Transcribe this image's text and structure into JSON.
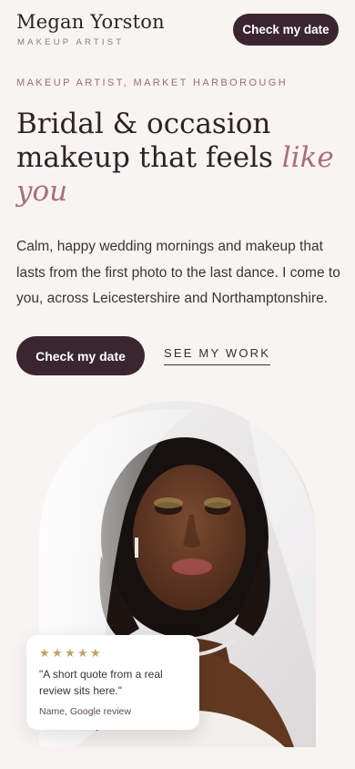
{
  "header": {
    "brand_name": "Megan Yorston",
    "brand_subtitle": "MAKEUP ARTIST",
    "cta_label": "Check my date"
  },
  "hero": {
    "eyebrow": "MAKEUP ARTIST, MARKET HARBOROUGH",
    "headline_line1": "Bridal & occasion",
    "headline_line2_plain": "makeup that feels ",
    "headline_accent": "like you",
    "lead": "Calm, happy wedding mornings and makeup that lasts from the first photo to the last dance. I come to you, across Leicestershire and Northamptonshire.",
    "primary_cta": "Check my date",
    "secondary_cta": "SEE MY WORK"
  },
  "review": {
    "rating": 5,
    "star_glyph": "★",
    "quote": "\"A short quote from a real review sits here.\"",
    "attribution": "Name, Google review"
  },
  "colors": {
    "background": "#f8f4f2",
    "button": "#3b2630",
    "accent": "#a86d83",
    "star": "#c3a160"
  }
}
